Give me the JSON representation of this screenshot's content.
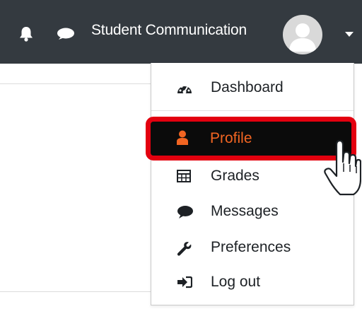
{
  "topbar": {
    "icons": [
      "bell-icon",
      "chat-icon"
    ],
    "user_name": "Student Communication",
    "avatar": "user-avatar",
    "menu_toggle_icon": "caret-down-icon"
  },
  "user_menu": {
    "items": [
      {
        "label": "Dashboard",
        "icon": "dashboard-gauge-icon"
      },
      {
        "label": "Profile",
        "icon": "user-icon",
        "highlighted": true
      },
      {
        "label": "Grades",
        "icon": "table-grid-icon"
      },
      {
        "label": "Messages",
        "icon": "speech-bubble-icon"
      },
      {
        "label": "Preferences",
        "icon": "wrench-icon"
      },
      {
        "label": "Log out",
        "icon": "sign-out-icon"
      }
    ]
  },
  "colors": {
    "topbar": "#343a40",
    "highlight_border": "#e3000f",
    "profile_text": "#f26522"
  },
  "cursor": "hand-pointer-icon"
}
